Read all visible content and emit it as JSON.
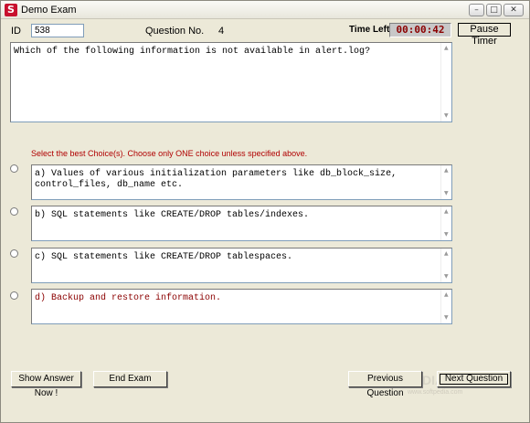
{
  "window": {
    "title": "Demo Exam",
    "app_icon_letter": "S"
  },
  "header": {
    "id_label": "ID",
    "id_value": "538",
    "question_no_label": "Question No.",
    "question_no_value": "4",
    "time_left_label": "Time Left:",
    "timer_value": "00:00:42",
    "pause_label": "Pause Timer"
  },
  "question": {
    "text": "Which of the following information is not available in alert.log?"
  },
  "instruction": "Select the best Choice(s). Choose only ONE choice unless specified above.",
  "choices": [
    {
      "text": "a) Values of various initialization parameters like db_block_size, control_files, db_name etc.",
      "selected": false
    },
    {
      "text": "b) SQL statements like CREATE/DROP tables/indexes.",
      "selected": false
    },
    {
      "text": "c) SQL statements like CREATE/DROP tablespaces.",
      "selected": false
    },
    {
      "text": "d) Backup and restore information.",
      "selected": false
    }
  ],
  "buttons": {
    "show_answer": "Show Answer Now !",
    "end_exam": "End Exam",
    "previous": "Previous Question",
    "next": "Next Question"
  },
  "watermark": "SOFTPEDIA",
  "watermark_url": "www.softpedia.com",
  "colors": {
    "timer_text": "#8b0000",
    "instruction_text": "#b00000",
    "window_bg": "#ece9d8"
  }
}
